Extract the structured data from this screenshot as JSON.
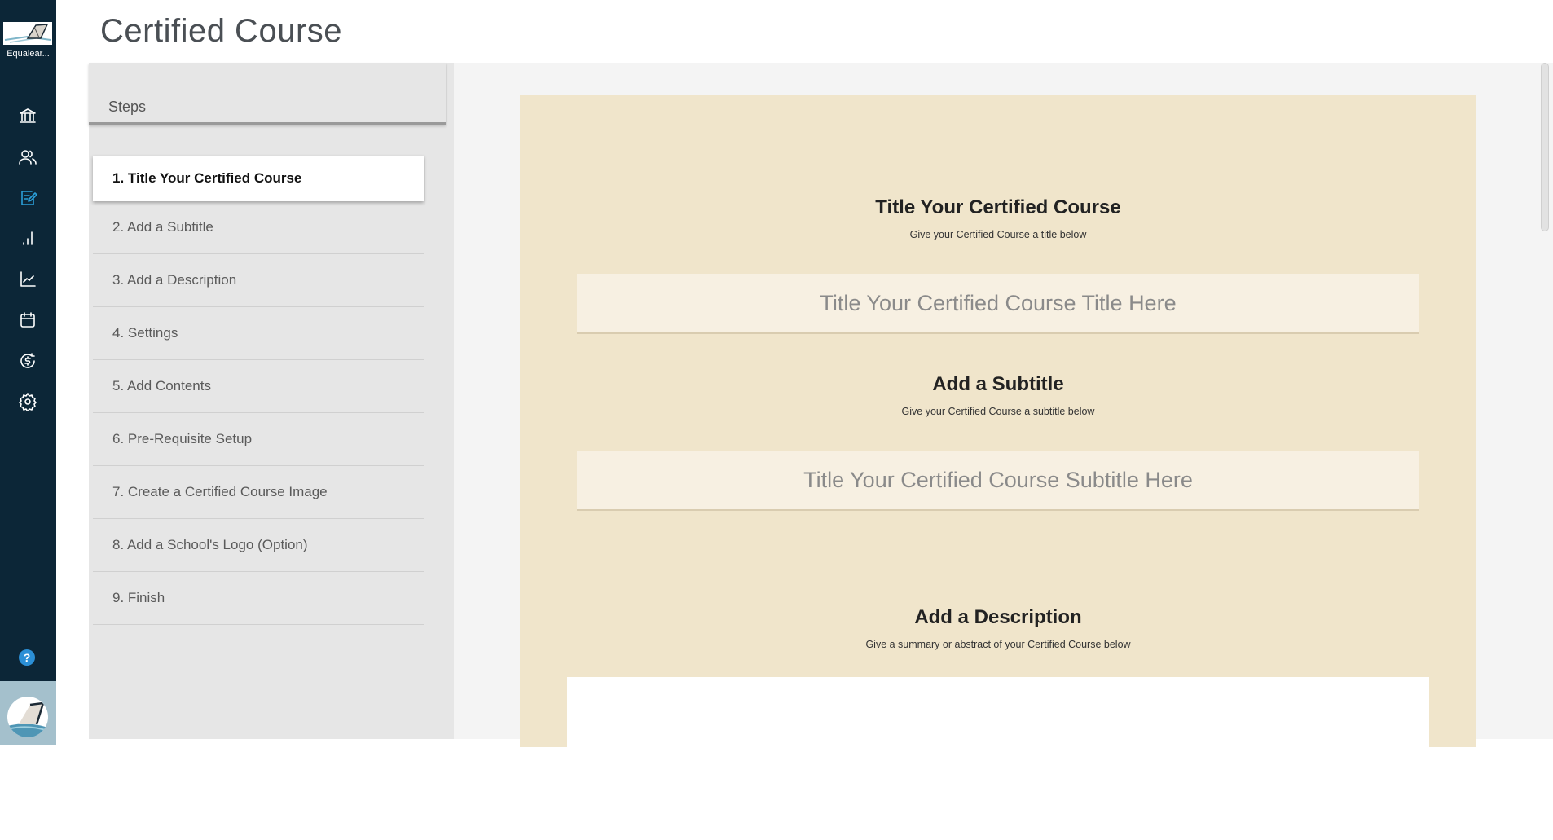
{
  "global_nav": {
    "brand_name": "Equalear...",
    "items": [
      {
        "icon": "institution-icon",
        "label": "Institution"
      },
      {
        "icon": "users-icon",
        "label": "Users"
      },
      {
        "icon": "edit-course-icon",
        "label": "Courses",
        "active": true
      },
      {
        "icon": "bar-chart-icon",
        "label": "Reports"
      },
      {
        "icon": "line-chart-icon",
        "label": "Analytics"
      },
      {
        "icon": "calendar-icon",
        "label": "Calendar"
      },
      {
        "icon": "dollar-icon",
        "label": "Payments"
      },
      {
        "icon": "gear-icon",
        "label": "Settings"
      }
    ],
    "help_label": "?",
    "accent_color": "#2b9fd9",
    "background_color": "#0c2637"
  },
  "page": {
    "title": "Certified Course"
  },
  "steps": {
    "header": "Steps",
    "items": [
      {
        "label": "1. Title Your Certified Course",
        "active": true
      },
      {
        "label": "2. Add a Subtitle"
      },
      {
        "label": "3. Add a Description"
      },
      {
        "label": "4. Settings"
      },
      {
        "label": "5. Add Contents"
      },
      {
        "label": "6. Pre-Requisite Setup"
      },
      {
        "label": "7. Create a Certified Course Image"
      },
      {
        "label": "8. Add a School's Logo (Option)"
      },
      {
        "label": "9. Finish"
      }
    ]
  },
  "form": {
    "title_section": {
      "heading": "Title Your Certified Course",
      "subheading": "Give your Certified Course a title below",
      "placeholder": "Title Your Certified Course Title Here",
      "value": ""
    },
    "subtitle_section": {
      "heading": "Add a Subtitle",
      "subheading": "Give your Certified Course a subtitle below",
      "placeholder": "Title Your Certified Course Subtitle Here",
      "value": ""
    },
    "description_section": {
      "heading": "Add a Description",
      "subheading": "Give a summary or abstract of your Certified Course below",
      "value": ""
    },
    "card_color": "#f0e5cb"
  }
}
